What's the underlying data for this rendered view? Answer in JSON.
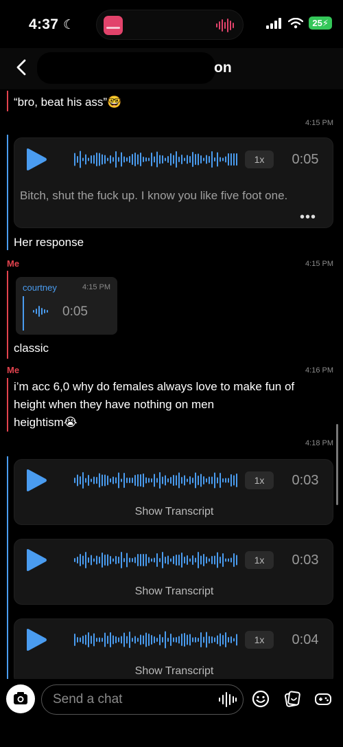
{
  "status_bar": {
    "time": "4:37",
    "battery": "25"
  },
  "header": {
    "title_visible": "on"
  },
  "messages": {
    "m1_text": "“bro, beat his ass”",
    "m1_emoji": "🤓",
    "ts1": "4:15 PM",
    "voice1": {
      "speed": "1x",
      "duration": "0:05",
      "transcript": "Bitch, shut the fuck up. I know you like five foot one.",
      "more": "•••"
    },
    "m2_text": "Her response",
    "sender2": "Me",
    "ts2": "4:15 PM",
    "quote": {
      "name": "courtney",
      "time": "4:15 PM",
      "duration": "0:05"
    },
    "m3_text": "classic",
    "sender3": "Me",
    "ts3": "4:16 PM",
    "m4_line1": "i’m acc 6,0 why do females always love to make fun of",
    "m4_line2": "height when they have nothing on men",
    "m4_line3": "heightism",
    "m4_emoji": "😭",
    "ts4": "4:18 PM",
    "voice2": {
      "speed": "1x",
      "duration": "0:03",
      "show_transcript": "Show Transcript"
    },
    "voice3": {
      "speed": "1x",
      "duration": "0:03",
      "show_transcript": "Show Transcript"
    },
    "voice4": {
      "speed": "1x",
      "duration": "0:04",
      "show_transcript": "Show Transcript"
    }
  },
  "composer": {
    "placeholder": "Send a chat"
  },
  "colors": {
    "accent_blue": "#4a9cf0",
    "me_red": "#e2434e",
    "battery_green": "#34c759"
  }
}
